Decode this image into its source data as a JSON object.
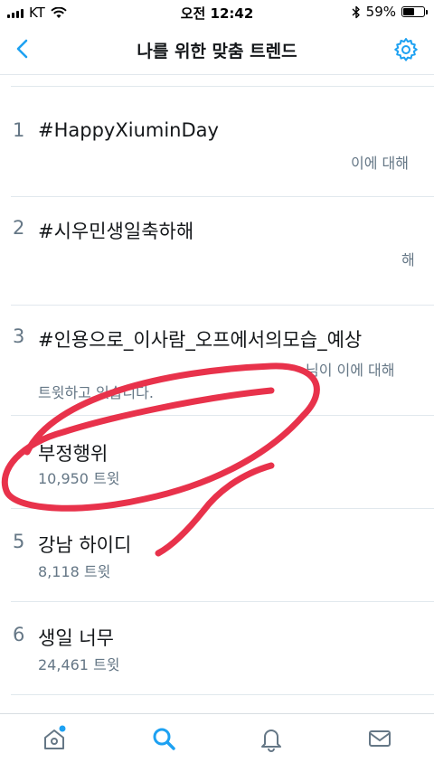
{
  "status_bar": {
    "carrier": "KT",
    "time": "오전 12:42",
    "battery_percent": "59%",
    "battery_level": 0.59
  },
  "nav": {
    "title": "나를 위한 맞춤 트렌드"
  },
  "trends": [
    {
      "rank": "1",
      "name": "#HappyXiuminDay",
      "desc_right": "이에 대해",
      "accent": "#1da1f2"
    },
    {
      "rank": "2",
      "name": "#시우민생일축하해",
      "desc_right": "해"
    },
    {
      "rank": "3",
      "name": "#인용으로_이사람_오프에서의모습_예상",
      "desc_right": "님이 이에 대해",
      "desc_left": "트윗하고 있습니다."
    },
    {
      "rank": "4",
      "name": "부정행위",
      "count": "10,950 트윗"
    },
    {
      "rank": "5",
      "name": "강남 하이디",
      "count": "8,118 트윗"
    },
    {
      "rank": "6",
      "name": "생일 너무",
      "count": "24,461 트윗"
    }
  ],
  "tabs": [
    {
      "name": "home",
      "icon": "home-icon"
    },
    {
      "name": "search",
      "icon": "search-icon",
      "active": true
    },
    {
      "name": "notifications",
      "icon": "bell-icon"
    },
    {
      "name": "messages",
      "icon": "mail-icon"
    }
  ],
  "colors": {
    "accent": "#1da1f2",
    "secondary_text": "#657786",
    "scribble": "#e8324b"
  }
}
